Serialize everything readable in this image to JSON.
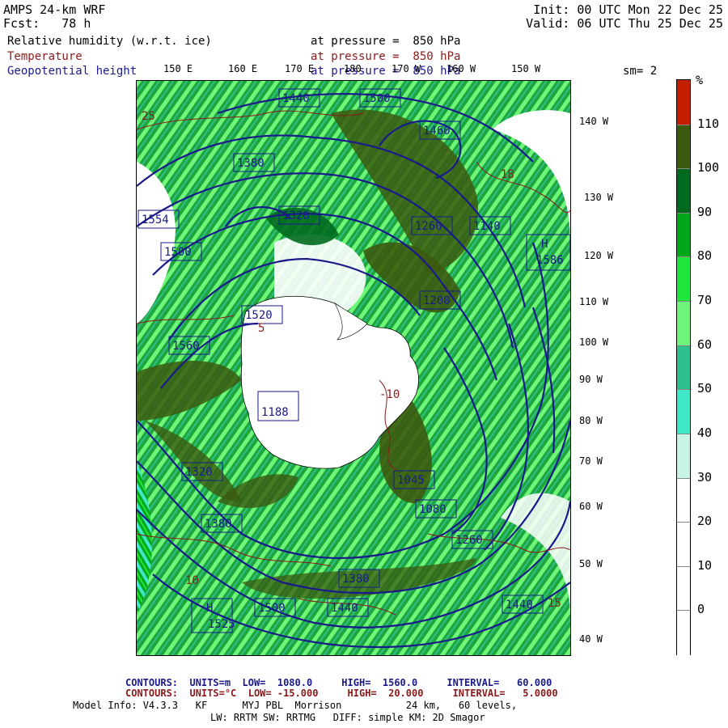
{
  "header": {
    "model": "AMPS 24-km WRF",
    "fcst": "Fcst:   78 h",
    "init": "Init: 00 UTC Mon 22 Dec 25",
    "valid": "Valid: 06 UTC Thu 25 Dec 25"
  },
  "fields": [
    {
      "name": "Relative humidity (w.r.t. ice)",
      "level": "at pressure =  850 hPa",
      "color": "#000000"
    },
    {
      "name": "Temperature",
      "level": "at pressure =  850 hPa",
      "color": "#8b1a1a"
    },
    {
      "name": "Geopotential height",
      "level": "at pressure =  850 hPa",
      "color": "#1a1a8b"
    }
  ],
  "smoothing": "sm= 2",
  "top_longitudes": [
    "150 E",
    "160 E",
    "170 E",
    "180",
    "170 W",
    "160 W",
    "150 W"
  ],
  "right_longitudes": [
    "140 W",
    "130 W",
    "120 W",
    "110 W",
    "100 W",
    "90 W",
    "80 W",
    "70 W",
    "60 W",
    "50 W",
    "40 W"
  ],
  "colorbar": {
    "unit": "%",
    "ticks": [
      "110",
      "100",
      "90",
      "80",
      "70",
      "60",
      "50",
      "40",
      "30",
      "20",
      "10",
      "0"
    ],
    "colors": [
      "#c41e00",
      "#3b5a10",
      "#006b1e",
      "#00a81a",
      "#1ee63a",
      "#6ef57a",
      "#2fbf8f",
      "#3fe8c8",
      "#c8f5e6",
      "#ffffff",
      "#ffffff",
      "#ffffff",
      "#ffffff"
    ]
  },
  "height_labels": [
    "1440",
    "1500",
    "1460",
    "1380",
    "1260",
    "1320",
    "1200",
    "1140",
    "1554",
    "1500",
    "1560",
    "1520",
    "1188",
    "1045",
    "1080",
    "1380",
    "1500",
    "1440",
    "1525",
    "1380",
    "1440",
    "1586",
    "1260",
    "1320"
  ],
  "temp_labels": [
    "25",
    "-10",
    "5",
    "18",
    "10",
    "15"
  ],
  "footer": {
    "contours1": "CONTOURS:  UNITS=m  LOW=  1080.0     HIGH=  1560.0     INTERVAL=   60.000",
    "contours2": "CONTOURS:  UNITS=°C  LOW= -15.000     HIGH=  20.000     INTERVAL=   5.0000",
    "model_info": "Model Info: V4.3.3   KF      MYJ PBL  Morrison           24 km,   60 levels,",
    "physics": "LW: RRTM SW: RRTMG   DIFF: simple KM: 2D Smagor"
  }
}
